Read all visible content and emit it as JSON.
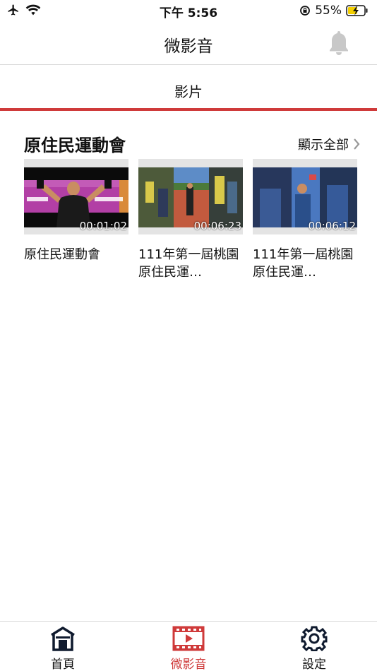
{
  "status_bar": {
    "time": "下午 5:56",
    "battery_percent": "55%",
    "icons": [
      "airplane-icon",
      "wifi-icon",
      "orientation-lock-icon",
      "battery-charging-icon"
    ]
  },
  "header": {
    "title": "微影音",
    "bell_icon": "bell-icon"
  },
  "tabs": [
    {
      "label": "影片",
      "active": true
    }
  ],
  "colors": {
    "accent": "#cf3a3a",
    "divider": "#d8d8d8"
  },
  "section": {
    "title": "原住民運動會",
    "show_all_label": "顯示全部",
    "videos": [
      {
        "title": "原住民運動會",
        "duration": "00:01:02"
      },
      {
        "title": "111年第一屆桃園原住民運…",
        "duration": "00:06:23"
      },
      {
        "title": "111年第一屆桃園原住民運…",
        "duration": "00:06:12"
      }
    ]
  },
  "bottom_nav": [
    {
      "label": "首頁",
      "icon": "home-icon",
      "active": false
    },
    {
      "label": "微影音",
      "icon": "film-icon",
      "active": true
    },
    {
      "label": "設定",
      "icon": "gear-icon",
      "active": false
    }
  ]
}
